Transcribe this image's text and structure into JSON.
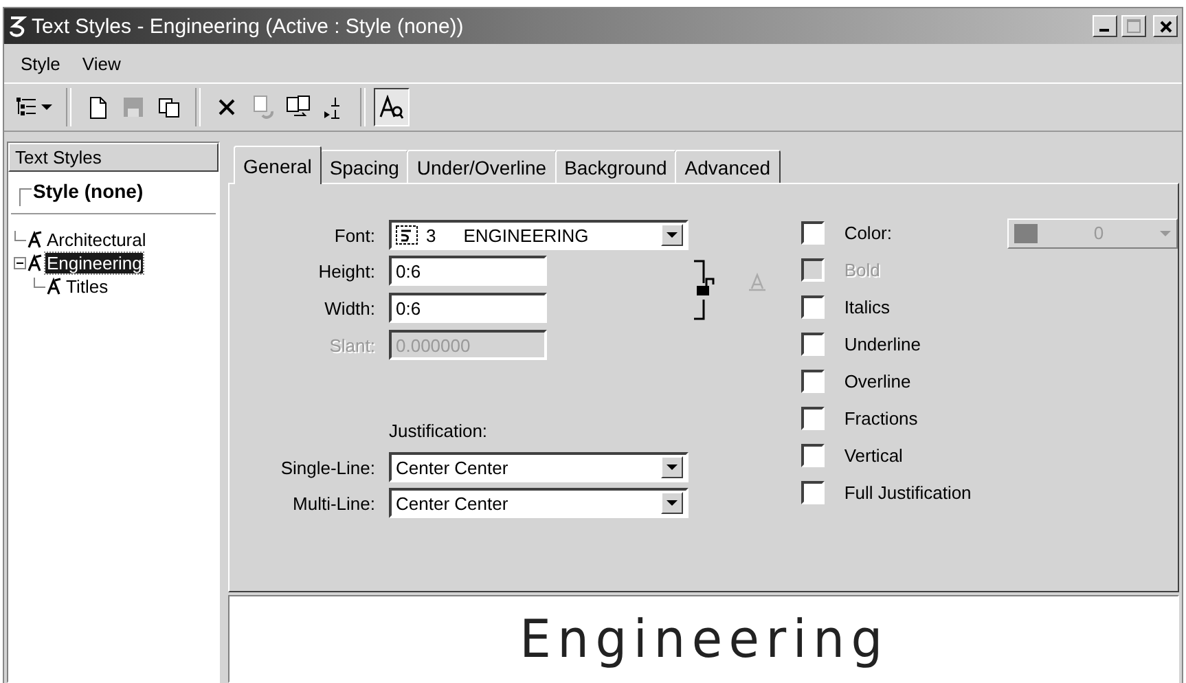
{
  "window": {
    "title": "Text Styles - Engineering (Active : Style (none))"
  },
  "menu": [
    {
      "label": "Style"
    },
    {
      "label": "View"
    }
  ],
  "toolbar": [
    {
      "kind": "tree",
      "disabled": false,
      "pressed": false
    },
    {
      "kind": "new",
      "disabled": false,
      "pressed": false
    },
    {
      "kind": "save",
      "disabled": true,
      "pressed": false
    },
    {
      "kind": "copy",
      "disabled": false,
      "pressed": false
    },
    {
      "kind": "delete",
      "disabled": false,
      "pressed": false
    },
    {
      "kind": "reset",
      "disabled": true,
      "pressed": false
    },
    {
      "kind": "compare",
      "disabled": false,
      "pressed": false
    },
    {
      "kind": "import",
      "disabled": false,
      "pressed": false
    },
    {
      "kind": "preview",
      "disabled": false,
      "pressed": true
    }
  ],
  "sidebar": {
    "header": "Text Styles",
    "root": "Style (none)",
    "items": [
      {
        "label": "Architectural",
        "selected": false
      },
      {
        "label": "Engineering",
        "selected": true,
        "expanded": true,
        "children": [
          {
            "label": "Titles",
            "selected": false
          }
        ]
      }
    ]
  },
  "tabs": [
    {
      "label": "General",
      "selected": true
    },
    {
      "label": "Spacing",
      "selected": false
    },
    {
      "label": "Under/Overline",
      "selected": false
    },
    {
      "label": "Background",
      "selected": false
    },
    {
      "label": "Advanced",
      "selected": false
    }
  ],
  "general": {
    "font": {
      "label": "Font:",
      "number": "3",
      "name": "ENGINEERING"
    },
    "height": {
      "label": "Height:",
      "value": "0:6"
    },
    "width": {
      "label": "Width:",
      "value": "0:6"
    },
    "lock": {
      "locked": false
    },
    "slant": {
      "label": "Slant:",
      "value": "0.000000",
      "disabled": true
    },
    "justification_heading": "Justification:",
    "single_line": {
      "label": "Single-Line:",
      "value": "Center Center"
    },
    "multi_line": {
      "label": "Multi-Line:",
      "value": "Center Center"
    },
    "options": [
      {
        "label": "Color:",
        "checked": false,
        "disabled": false
      },
      {
        "label": "Bold",
        "checked": false,
        "disabled": true
      },
      {
        "label": "Italics",
        "checked": false,
        "disabled": false
      },
      {
        "label": "Underline",
        "checked": false,
        "disabled": false
      },
      {
        "label": "Overline",
        "checked": false,
        "disabled": false
      },
      {
        "label": "Fractions",
        "checked": false,
        "disabled": false
      },
      {
        "label": "Vertical",
        "checked": false,
        "disabled": false
      },
      {
        "label": "Full Justification",
        "checked": false,
        "disabled": false
      }
    ],
    "color_picker": {
      "value": "0",
      "disabled": true
    }
  },
  "preview": {
    "text": "Engineering"
  }
}
